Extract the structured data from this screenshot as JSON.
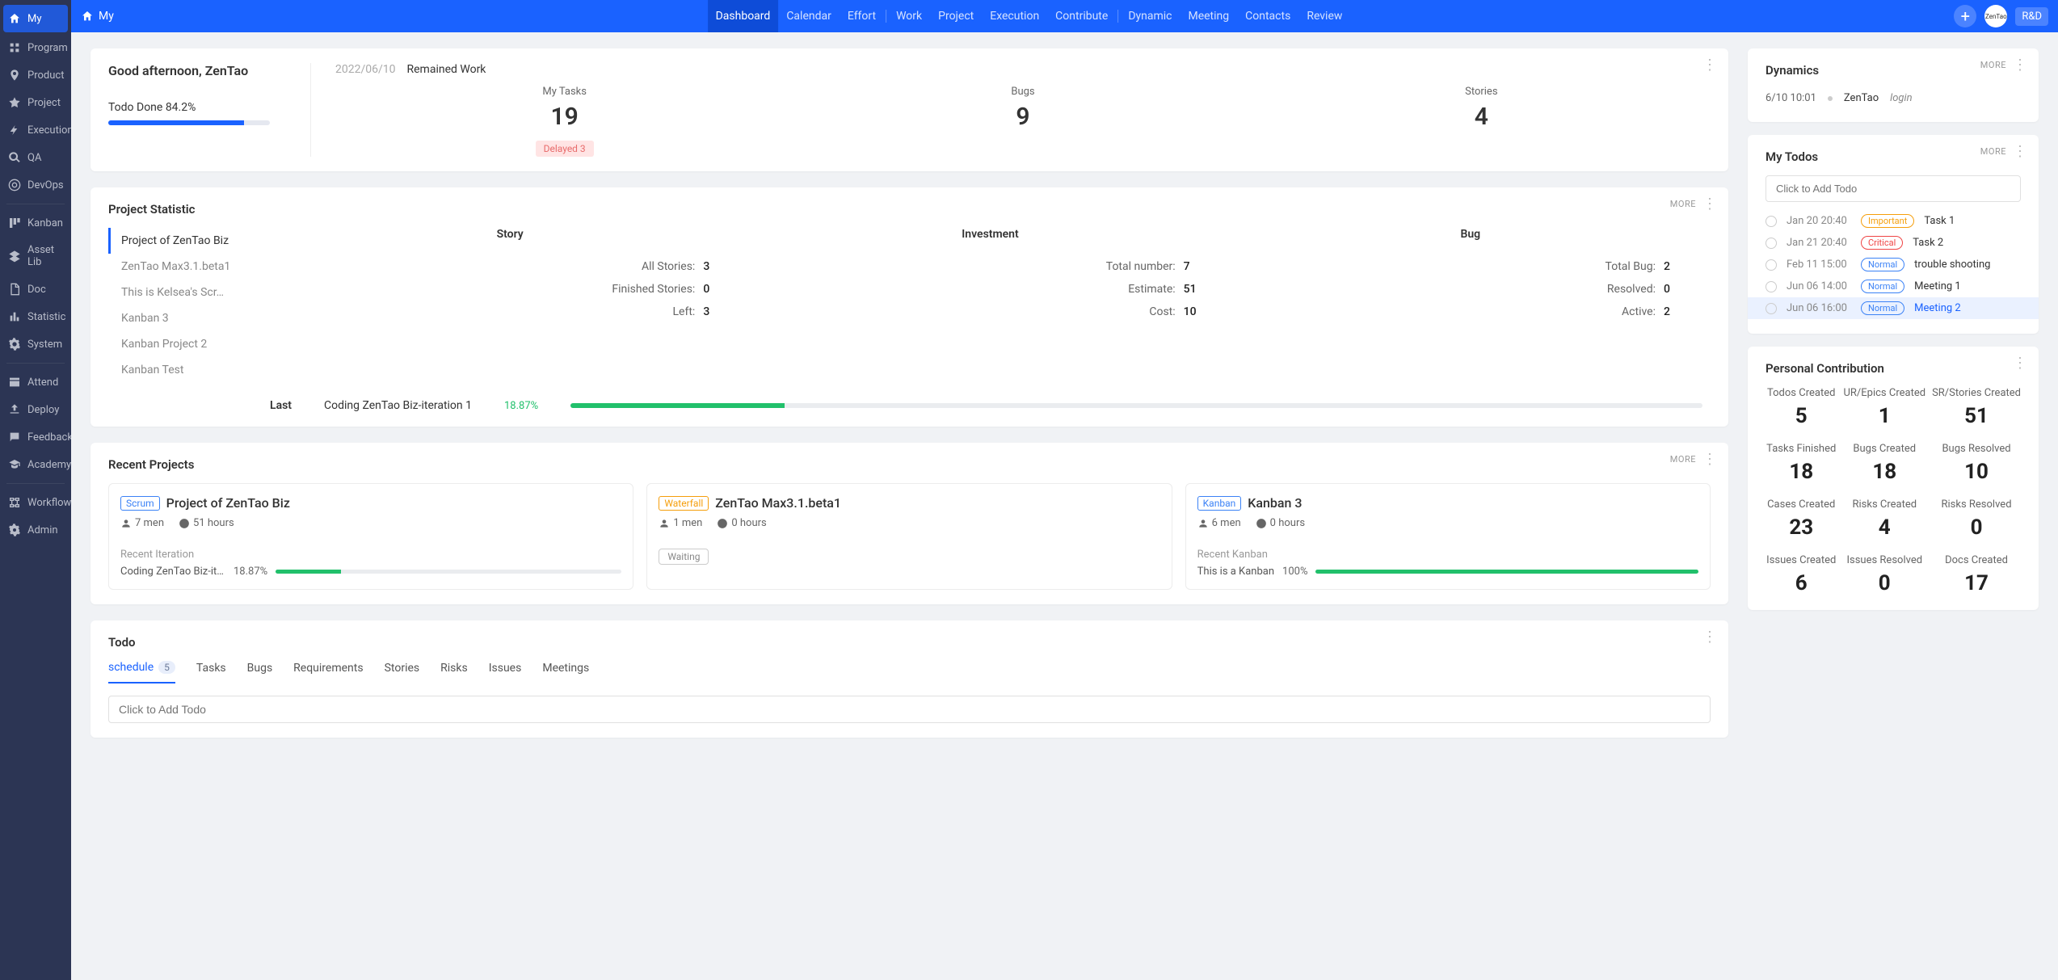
{
  "sidebar": {
    "items": [
      {
        "label": "My",
        "icon": "home"
      },
      {
        "label": "Program",
        "icon": "program"
      },
      {
        "label": "Product",
        "icon": "product"
      },
      {
        "label": "Project",
        "icon": "project"
      },
      {
        "label": "Execution",
        "icon": "execution"
      },
      {
        "label": "QA",
        "icon": "qa"
      },
      {
        "label": "DevOps",
        "icon": "devops"
      },
      {
        "label": "Kanban",
        "icon": "kanban"
      },
      {
        "label": "Asset Lib",
        "icon": "asset"
      },
      {
        "label": "Doc",
        "icon": "doc"
      },
      {
        "label": "Statistic",
        "icon": "statistic"
      },
      {
        "label": "System",
        "icon": "system"
      },
      {
        "label": "Attend",
        "icon": "attend"
      },
      {
        "label": "Deploy",
        "icon": "deploy"
      },
      {
        "label": "Feedback",
        "icon": "feedback"
      },
      {
        "label": "Academy",
        "icon": "academy"
      },
      {
        "label": "Workflow",
        "icon": "workflow"
      },
      {
        "label": "Admin",
        "icon": "admin"
      }
    ]
  },
  "topbar": {
    "crumb": "My",
    "nav": [
      "Dashboard",
      "Calendar",
      "Effort",
      "Work",
      "Project",
      "Execution",
      "Contribute",
      "Dynamic",
      "Meeting",
      "Contacts",
      "Review"
    ],
    "role": "R&D",
    "logo": "ZenTao"
  },
  "greeting": {
    "title": "Good afternoon, ZenTao",
    "todo_label": "Todo Done 84.2%",
    "todo_pct": 84.2,
    "date": "2022/06/10",
    "remained": "Remained Work",
    "stats": [
      {
        "label": "My Tasks",
        "val": "19",
        "tag": "Delayed 3"
      },
      {
        "label": "Bugs",
        "val": "9"
      },
      {
        "label": "Stories",
        "val": "4"
      }
    ]
  },
  "project_stat": {
    "title": "Project Statistic",
    "more": "MORE",
    "projects": [
      "Project of ZenTao Biz",
      "ZenTao Max3.1.beta1",
      "This is Kelsea's Scr…",
      "Kanban 3",
      "Kanban Project 2",
      "Kanban Test"
    ],
    "cols": [
      {
        "h": "Story",
        "rows": [
          [
            "All Stories:",
            "3"
          ],
          [
            "Finished Stories:",
            "0"
          ],
          [
            "Left:",
            "3"
          ]
        ]
      },
      {
        "h": "Investment",
        "rows": [
          [
            "Total number:",
            "7"
          ],
          [
            "Estimate:",
            "51"
          ],
          [
            "Cost:",
            "10"
          ]
        ]
      },
      {
        "h": "Bug",
        "rows": [
          [
            "Total Bug:",
            "2"
          ],
          [
            "Resolved:",
            "0"
          ],
          [
            "Active:",
            "2"
          ]
        ]
      }
    ],
    "last": {
      "label": "Last",
      "name": "Coding ZenTao Biz-iteration 1",
      "pct": "18.87%",
      "pctNum": 18.87
    }
  },
  "recent": {
    "title": "Recent Projects",
    "more": "MORE",
    "cards": [
      {
        "tag": "Scrum",
        "tagCls": "scrum",
        "name": "Project of ZenTao Biz",
        "men": "7 men",
        "hours": "51 hours",
        "recentLabel": "Recent Iteration",
        "recentName": "Coding ZenTao Biz-itera...",
        "pct": "18.87%",
        "pctNum": 18.87
      },
      {
        "tag": "Waterfall",
        "tagCls": "waterfall",
        "name": "ZenTao Max3.1.beta1",
        "men": "1 men",
        "hours": "0 hours",
        "waiting": "Waiting"
      },
      {
        "tag": "Kanban",
        "tagCls": "kanban",
        "name": "Kanban 3",
        "men": "6 men",
        "hours": "0 hours",
        "recentLabel": "Recent Kanban",
        "recentName": "This is a Kanban",
        "pct": "100%",
        "pctNum": 100
      }
    ]
  },
  "todo": {
    "title": "Todo",
    "tabs": [
      {
        "label": "schedule",
        "badge": "5",
        "active": true
      },
      {
        "label": "Tasks"
      },
      {
        "label": "Bugs"
      },
      {
        "label": "Requirements"
      },
      {
        "label": "Stories"
      },
      {
        "label": "Risks"
      },
      {
        "label": "Issues"
      },
      {
        "label": "Meetings"
      }
    ],
    "placeholder": "Click to Add Todo"
  },
  "dynamics": {
    "title": "Dynamics",
    "more": "MORE",
    "rows": [
      {
        "time": "6/10 10:01",
        "user": "ZenTao",
        "action": "login"
      }
    ]
  },
  "mytodos": {
    "title": "My Todos",
    "more": "MORE",
    "placeholder": "Click to Add Todo",
    "items": [
      {
        "date": "Jan 20 20:40",
        "pri": "Important",
        "priCls": "important",
        "name": "Task 1"
      },
      {
        "date": "Jan 21 20:40",
        "pri": "Critical",
        "priCls": "critical",
        "name": "Task 2"
      },
      {
        "date": "Feb 11 15:00",
        "pri": "Normal",
        "priCls": "normal",
        "name": "trouble shooting"
      },
      {
        "date": "Jun 06 14:00",
        "pri": "Normal",
        "priCls": "normal",
        "name": "Meeting 1"
      },
      {
        "date": "Jun 06 16:00",
        "pri": "Normal",
        "priCls": "normal",
        "name": "Meeting 2",
        "link": true,
        "hl": true
      }
    ]
  },
  "contribution": {
    "title": "Personal Contribution",
    "items": [
      {
        "label": "Todos Created",
        "val": "5"
      },
      {
        "label": "UR/Epics Created",
        "val": "1"
      },
      {
        "label": "SR/Stories Created",
        "val": "51"
      },
      {
        "label": "Tasks Finished",
        "val": "18"
      },
      {
        "label": "Bugs Created",
        "val": "18"
      },
      {
        "label": "Bugs Resolved",
        "val": "10"
      },
      {
        "label": "Cases Created",
        "val": "23"
      },
      {
        "label": "Risks Created",
        "val": "4"
      },
      {
        "label": "Risks Resolved",
        "val": "0"
      },
      {
        "label": "Issues Created",
        "val": "6"
      },
      {
        "label": "Issues Resolved",
        "val": "0"
      },
      {
        "label": "Docs Created",
        "val": "17"
      }
    ]
  }
}
